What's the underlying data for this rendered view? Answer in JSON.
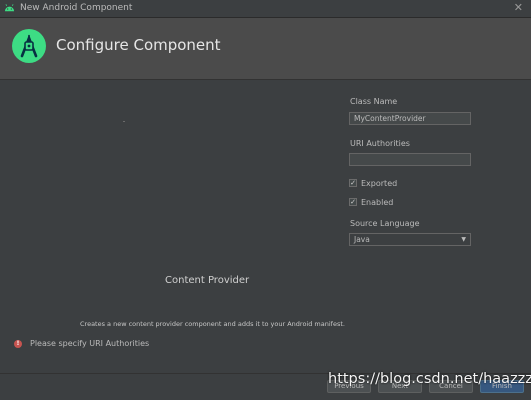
{
  "window": {
    "title": "New Android Component",
    "close_glyph": "✕"
  },
  "header": {
    "title": "Configure Component",
    "logo_icon": "android-studio-logo"
  },
  "preview": {
    "component_name": "Content Provider",
    "description": "Creates a new content provider component and adds it to your Android manifest."
  },
  "form": {
    "class_name_label": "Class Name",
    "class_name_value": "MyContentProvider",
    "uri_label": "URI Authorities",
    "uri_value": "",
    "exported_label": "Exported",
    "exported_checked": true,
    "enabled_label": "Enabled",
    "enabled_checked": true,
    "language_label": "Source Language",
    "language_value": "Java"
  },
  "error": {
    "message": "Please specify URI Authorities"
  },
  "footer": {
    "previous_label": "Previous",
    "next_label": "Next",
    "cancel_label": "Cancel",
    "finish_label": "Finish"
  },
  "watermark": "https://blog.csdn.net/haazzz",
  "colors": {
    "background": "#3c3f41",
    "header": "#4b4b4b",
    "android_green": "#3ddc84",
    "error": "#c75450"
  }
}
